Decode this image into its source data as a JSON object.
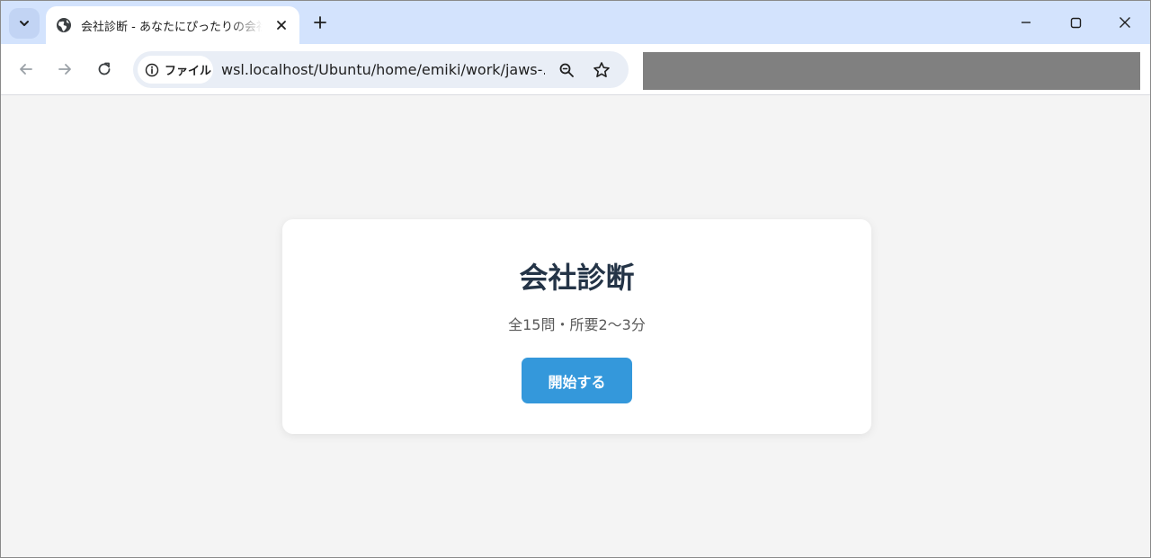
{
  "browser": {
    "tab": {
      "title": "会社診断 - あなたにぴったりの会社"
    },
    "address": {
      "security_label": "ファイル",
      "url": "wsl.localhost/Ubuntu/home/emiki/work/jaws-..."
    }
  },
  "page": {
    "title": "会社診断",
    "subtitle": "全15問・所要2〜3分",
    "start_button": "開始する"
  },
  "colors": {
    "tabstrip": "#d3e3fd",
    "primary_button": "#3498db",
    "title_text": "#243447",
    "page_background": "#f4f4f4"
  },
  "icons": {
    "tab_search": "chevron-down-icon",
    "favicon": "globe-icon",
    "tab_close": "close-icon",
    "new_tab": "plus-icon",
    "minimize": "minimize-icon",
    "maximize": "maximize-icon",
    "close_window": "close-icon",
    "back": "arrow-left-icon",
    "forward": "arrow-right-icon",
    "reload": "reload-icon",
    "info": "info-icon",
    "zoom": "magnifier-icon",
    "bookmark": "star-icon"
  }
}
